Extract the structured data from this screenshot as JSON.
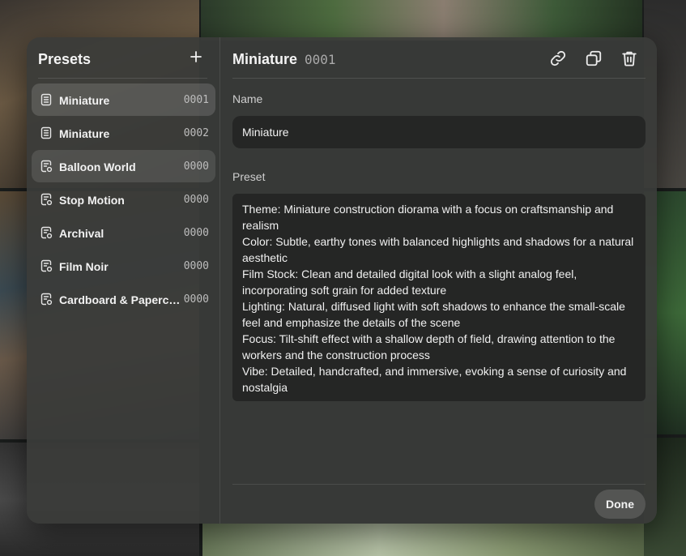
{
  "sidebar": {
    "title": "Presets",
    "add_icon": "plus-icon",
    "items": [
      {
        "name": "Miniature",
        "code": "0001",
        "icon": "document-icon",
        "state": "selected"
      },
      {
        "name": "Miniature",
        "code": "0002",
        "icon": "document-icon",
        "state": "normal"
      },
      {
        "name": "Balloon World",
        "code": "0000",
        "icon": "document-gear-icon",
        "state": "highlight"
      },
      {
        "name": "Stop Motion",
        "code": "0000",
        "icon": "document-gear-icon",
        "state": "normal"
      },
      {
        "name": "Archival",
        "code": "0000",
        "icon": "document-gear-icon",
        "state": "normal"
      },
      {
        "name": "Film Noir",
        "code": "0000",
        "icon": "document-gear-icon",
        "state": "normal"
      },
      {
        "name": "Cardboard & Papercraft",
        "code": "0000",
        "icon": "document-gear-icon",
        "state": "normal"
      }
    ]
  },
  "main": {
    "title": "Miniature",
    "code": "0001",
    "actions": [
      {
        "icon": "link-icon"
      },
      {
        "icon": "duplicate-icon"
      },
      {
        "icon": "trash-icon"
      }
    ],
    "name_label": "Name",
    "name_value": "Miniature",
    "preset_label": "Preset",
    "preset_value": "Theme: Miniature construction diorama with a focus on craftsmanship and realism\nColor: Subtle, earthy tones with balanced highlights and shadows for a natural aesthetic\nFilm Stock: Clean and detailed digital look with a slight analog feel, incorporating soft grain for added texture\nLighting: Natural, diffused light with soft shadows to enhance the small-scale feel and emphasize the details of the scene\nFocus: Tilt-shift effect with a shallow depth of field, drawing attention to the workers and the construction process\nVibe: Detailed, handcrafted, and immersive, evoking a sense of curiosity and nostalgia",
    "done_label": "Done"
  },
  "colors": {
    "modal_bg": "#3a3b39",
    "input_bg": "#252625",
    "done_bg": "#545553",
    "text": "#f2f2f2",
    "muted": "#bdbdbd"
  }
}
